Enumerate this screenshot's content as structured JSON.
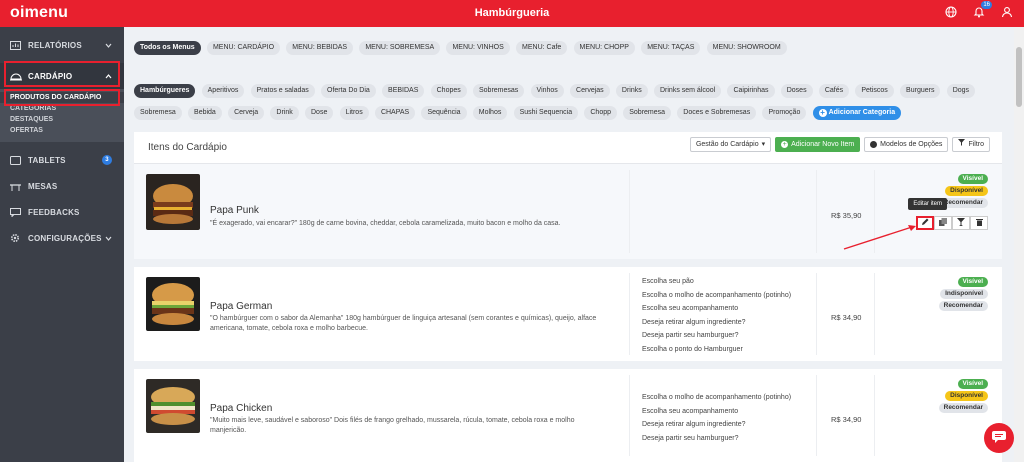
{
  "app": {
    "logo": "oimenu",
    "title": "Hambúrgueria",
    "notification_count": "16"
  },
  "sidebar": {
    "items": [
      {
        "label": "RELATÓRIOS",
        "icon": "chart-icon"
      },
      {
        "label": "CARDÁPIO",
        "icon": "cloche-icon"
      },
      {
        "label": "TABLETS",
        "icon": "tablet-icon",
        "badge": "3"
      },
      {
        "label": "MESAS",
        "icon": "table-icon"
      },
      {
        "label": "FEEDBACKS",
        "icon": "chat-icon"
      },
      {
        "label": "CONFIGURAÇÕES",
        "icon": "gear-icon"
      }
    ],
    "sub_items": [
      "PRODUTOS DO CARDÁPIO",
      "CATEGORIAS",
      "DESTAQUES",
      "OFERTAS"
    ]
  },
  "menus": [
    "Todos os Menus",
    "MENU: CARDÁPIO",
    "MENU: BEBIDAS",
    "MENU: SOBREMESA",
    "MENU: VINHOS",
    "MENU: Cafe",
    "MENU: CHOPP",
    "MENU: TAÇAS",
    "MENU: SHOWROOM"
  ],
  "categories_row1": [
    "Hambúrgueres",
    "Aperitivos",
    "Pratos e saladas",
    "Oferta Do Dia",
    "BEBIDAS",
    "Chopes",
    "Sobremesas",
    "Vinhos",
    "Cervejas",
    "Drinks",
    "Drinks sem álcool",
    "Caipirinhas",
    "Doses",
    "Cafés",
    "Petiscos",
    "Burguers",
    "Dogs"
  ],
  "categories_row2": [
    "Sobremesa",
    "Bebida",
    "Cerveja",
    "Drink",
    "Dose",
    "Litros",
    "CHAPAS",
    "Sequência",
    "Molhos",
    "Sushi Sequencia",
    "Chopp",
    "Sobremesa",
    "Doces e Sobremesas",
    "Promoção"
  ],
  "add_category": "Adicionar Categoria",
  "panel": {
    "title": "Itens do Cardápio",
    "manage": "Gestão do Cardápio",
    "add_item": "Adicionar Novo Item",
    "models": "Modelos de Opções",
    "filter": "Filtro",
    "tooltip": "Editar item"
  },
  "items": [
    {
      "name": "Papa Punk",
      "desc": "\"É exagerado, vai encarar?\" 180g de carne bovina, cheddar, cebola caramelizada, muito bacon e molho da casa.",
      "price": "R$ 35,90",
      "options": [],
      "status": [
        "Visível",
        "Disponível",
        "Recomendar"
      ]
    },
    {
      "name": "Papa German",
      "desc": "\"O hambúrguer com o sabor da Alemanha\" 180g hambúrguer de linguiça artesanal (sem corantes e químicas), queijo, alface americana, tomate, cebola roxa e molho barbecue.",
      "price": "R$ 34,90",
      "options": [
        "Escolha seu pão",
        "Escolha o molho de acompanhamento (potinho)",
        "Escolha seu acompanhamento",
        "Deseja retirar algum ingrediente?",
        "Deseja partir seu hamburguer?",
        "Escolha o ponto do Hamburguer"
      ],
      "status": [
        "Visível",
        "Indisponível",
        "Recomendar"
      ]
    },
    {
      "name": "Papa Chicken",
      "desc": "\"Muito mais leve, saudável e saboroso\" Dois filés de frango grelhado, mussarela, rúcula, tomate, cebola roxa e molho manjericão.",
      "price": "R$ 34,90",
      "options": [
        "Escolha o molho de acompanhamento (potinho)",
        "Escolha seu acompanhamento",
        "Deseja retirar algum ingrediente?",
        "Deseja partir seu hamburguer?"
      ],
      "status": [
        "Visível",
        "Disponível",
        "Recomendar"
      ]
    }
  ],
  "colors": {
    "brand": "#e8202e",
    "sidebar": "#3b3f48",
    "green": "#4caf50",
    "yellow": "#f5c518",
    "blue": "#2f8fe8"
  }
}
